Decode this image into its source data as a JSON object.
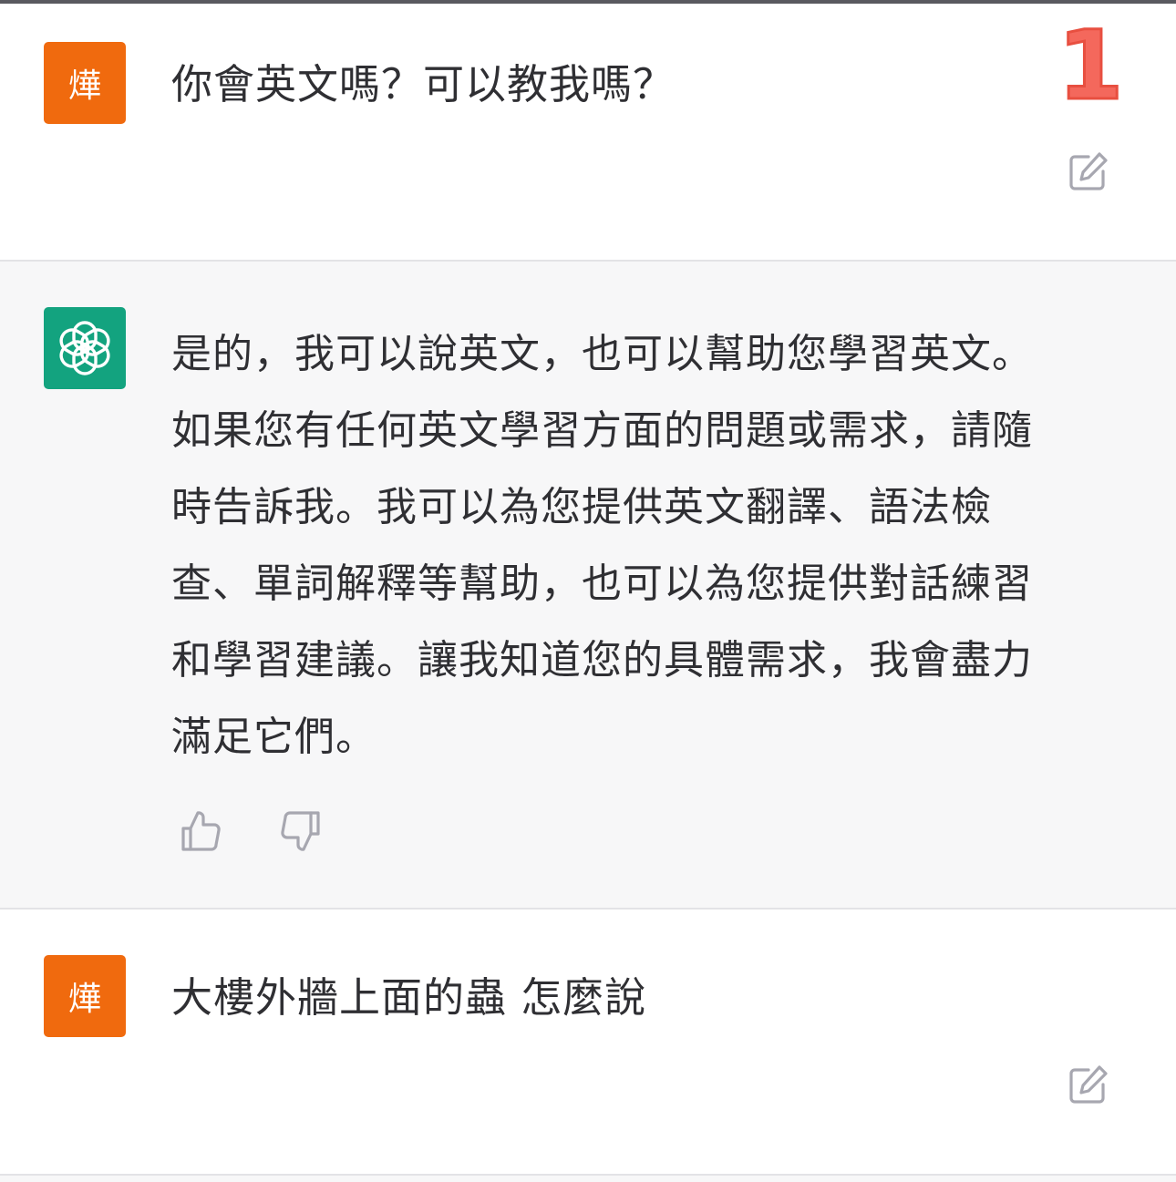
{
  "conversation": {
    "user_avatar_text": "燁",
    "badge": "1",
    "messages": [
      {
        "role": "user",
        "text": "你會英文嗎？可以教我嗎？"
      },
      {
        "role": "assistant",
        "lines": [
          "是的，我可以說英文，也可以幫助您學習英文。",
          "如果您有任何英文學習方面的問題或需求，請隨",
          "時告訴我。我可以為您提供英文翻譯、語法檢",
          "查、單詞解釋等幫助，也可以為您提供對話練習",
          "和學習建議。讓我知道您的具體需求，我會盡力",
          "滿足它們。"
        ]
      },
      {
        "role": "user",
        "text": "大樓外牆上面的蟲 怎麼說"
      }
    ]
  },
  "icons": {
    "edit": "edit-icon",
    "thumbs_up": "thumbs-up-icon",
    "thumbs_down": "thumbs-down-icon",
    "assistant_logo": "openai-logo-icon"
  },
  "colors": {
    "user_avatar": "#f06a0e",
    "assistant_avatar": "#13a37f",
    "assistant_background": "#f7f7f8",
    "badge": "#f4685c"
  }
}
